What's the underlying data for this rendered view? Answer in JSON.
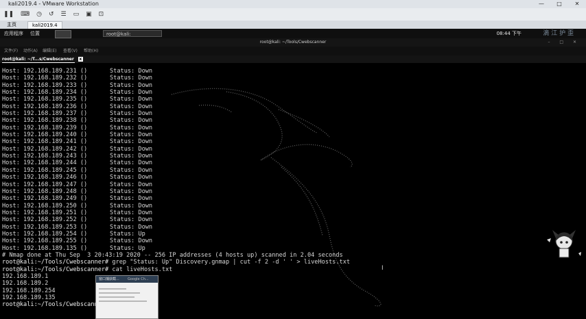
{
  "vm_window": {
    "title": "kali2019.4 - VMware Workstation",
    "controls": [
      "—",
      "□",
      "✕"
    ],
    "toolbar_icons": [
      "pause-icon",
      "send-keys-icon",
      "snapshot-icon",
      "restore-icon",
      "manage-icon",
      "fullscreen-icon",
      "unity-icon",
      "view-icon"
    ],
    "tabs": [
      {
        "label": "主页"
      },
      {
        "label": "kali2019.4"
      }
    ]
  },
  "kali_panel": {
    "apps_label": "应用程序",
    "places_label": "位置",
    "task_label": "root@kali: ~/Tools/Cweb...",
    "clock": "08:44 下午",
    "watermark": "滴 江 护 歪"
  },
  "terminal": {
    "window_title": "root@kali: ~/Tools/Cwebscanner",
    "menu": [
      "文件(F)",
      "动作(A)",
      "编辑(E)",
      "查看(V)",
      "帮助(H)"
    ],
    "tab_label": "root@kali: ~/T...s/Cwebscanner",
    "hosts": [
      {
        "host": "Host: 192.168.189.231 ()",
        "status": "Status: Down"
      },
      {
        "host": "Host: 192.168.189.232 ()",
        "status": "Status: Down"
      },
      {
        "host": "Host: 192.168.189.233 ()",
        "status": "Status: Down"
      },
      {
        "host": "Host: 192.168.189.234 ()",
        "status": "Status: Down"
      },
      {
        "host": "Host: 192.168.189.235 ()",
        "status": "Status: Down"
      },
      {
        "host": "Host: 192.168.189.236 ()",
        "status": "Status: Down"
      },
      {
        "host": "Host: 192.168.189.237 ()",
        "status": "Status: Down"
      },
      {
        "host": "Host: 192.168.189.238 ()",
        "status": "Status: Down"
      },
      {
        "host": "Host: 192.168.189.239 ()",
        "status": "Status: Down"
      },
      {
        "host": "Host: 192.168.189.240 ()",
        "status": "Status: Down"
      },
      {
        "host": "Host: 192.168.189.241 ()",
        "status": "Status: Down"
      },
      {
        "host": "Host: 192.168.189.242 ()",
        "status": "Status: Down"
      },
      {
        "host": "Host: 192.168.189.243 ()",
        "status": "Status: Down"
      },
      {
        "host": "Host: 192.168.189.244 ()",
        "status": "Status: Down"
      },
      {
        "host": "Host: 192.168.189.245 ()",
        "status": "Status: Down"
      },
      {
        "host": "Host: 192.168.189.246 ()",
        "status": "Status: Down"
      },
      {
        "host": "Host: 192.168.189.247 ()",
        "status": "Status: Down"
      },
      {
        "host": "Host: 192.168.189.248 ()",
        "status": "Status: Down"
      },
      {
        "host": "Host: 192.168.189.249 ()",
        "status": "Status: Down"
      },
      {
        "host": "Host: 192.168.189.250 ()",
        "status": "Status: Down"
      },
      {
        "host": "Host: 192.168.189.251 ()",
        "status": "Status: Down"
      },
      {
        "host": "Host: 192.168.189.252 ()",
        "status": "Status: Down"
      },
      {
        "host": "Host: 192.168.189.253 ()",
        "status": "Status: Down"
      },
      {
        "host": "Host: 192.168.189.254 ()",
        "status": "Status: Up"
      },
      {
        "host": "Host: 192.168.189.255 ()",
        "status": "Status: Down"
      },
      {
        "host": "Host: 192.168.189.135 ()",
        "status": "Status: Up"
      }
    ],
    "nmap_done": "# Nmap done at Thu Sep  3 20:43:19 2020 -- 256 IP addresses (4 hosts up) scanned in 2.04 seconds",
    "prompt": "root@kali:~/Tools/Cwebscanner#",
    "cmd1": " grep \"Status: Up\" Discovery.gnmap | cut -f 2 -d ' ' > liveHosts.txt",
    "cmd2": " cat liveHosts.txt",
    "live_hosts": [
      "192.168.189.1",
      "192.168.189.2",
      "192.168.189.254",
      "192.168.189.135"
    ],
    "last_prompt": "root@kali:~/Tools/Cwebscanne"
  },
  "popup": {
    "title": "窗口捕获截... ",
    "app": "Google Ch..."
  },
  "colors": {
    "terminal_bg": "#000000",
    "terminal_fg": "#d8d8d8",
    "vmware_chrome": "#dfe3e8"
  }
}
